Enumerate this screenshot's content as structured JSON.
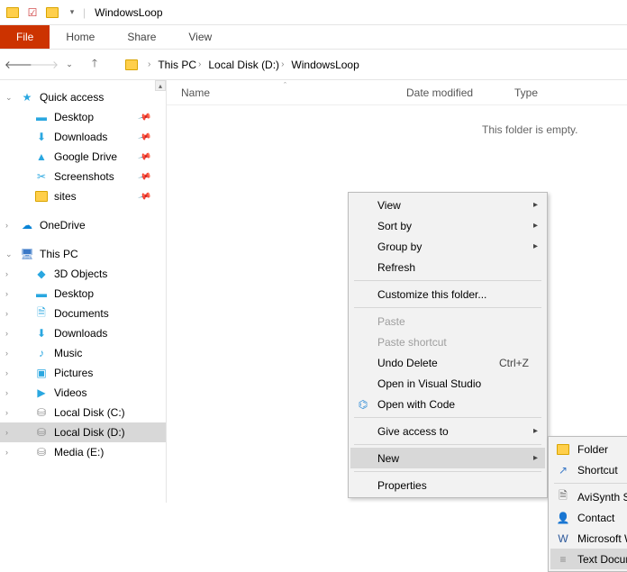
{
  "window": {
    "title": "WindowsLoop"
  },
  "ribbon": {
    "file": "File",
    "tabs": [
      "Home",
      "Share",
      "View"
    ]
  },
  "breadcrumb": [
    "This PC",
    "Local Disk (D:)",
    "WindowsLoop"
  ],
  "columns": {
    "name": "Name",
    "date": "Date modified",
    "type": "Type"
  },
  "empty_message": "This folder is empty.",
  "sidebar": {
    "quick_access": "Quick access",
    "qa_items": [
      {
        "label": "Desktop",
        "icon": "desktop",
        "pinned": true
      },
      {
        "label": "Downloads",
        "icon": "downloads",
        "pinned": true
      },
      {
        "label": "Google Drive",
        "icon": "gdrive",
        "pinned": true
      },
      {
        "label": "Screenshots",
        "icon": "scissors",
        "pinned": true
      },
      {
        "label": "sites",
        "icon": "folder",
        "pinned": true
      }
    ],
    "onedrive": "OneDrive",
    "this_pc": "This PC",
    "pc_items": [
      {
        "label": "3D Objects",
        "icon": "3d"
      },
      {
        "label": "Desktop",
        "icon": "desktop"
      },
      {
        "label": "Documents",
        "icon": "docs"
      },
      {
        "label": "Downloads",
        "icon": "downloads"
      },
      {
        "label": "Music",
        "icon": "music"
      },
      {
        "label": "Pictures",
        "icon": "pictures"
      },
      {
        "label": "Videos",
        "icon": "videos"
      },
      {
        "label": "Local Disk (C:)",
        "icon": "disk"
      },
      {
        "label": "Local Disk (D:)",
        "icon": "disk",
        "selected": true
      },
      {
        "label": "Media (E:)",
        "icon": "disk"
      }
    ]
  },
  "ctx_main": [
    {
      "label": "View",
      "arrow": true
    },
    {
      "label": "Sort by",
      "arrow": true
    },
    {
      "label": "Group by",
      "arrow": true
    },
    {
      "label": "Refresh"
    },
    {
      "sep": true
    },
    {
      "label": "Customize this folder..."
    },
    {
      "sep": true
    },
    {
      "label": "Paste",
      "disabled": true
    },
    {
      "label": "Paste shortcut",
      "disabled": true
    },
    {
      "label": "Undo Delete",
      "shortcut": "Ctrl+Z"
    },
    {
      "label": "Open in Visual Studio"
    },
    {
      "label": "Open with Code",
      "icon": "vscode"
    },
    {
      "sep": true
    },
    {
      "label": "Give access to",
      "arrow": true
    },
    {
      "sep": true
    },
    {
      "label": "New",
      "arrow": true,
      "hover": true
    },
    {
      "sep": true
    },
    {
      "label": "Properties"
    }
  ],
  "ctx_new": [
    {
      "label": "Folder",
      "icon": "folder"
    },
    {
      "label": "Shortcut",
      "icon": "shortcut"
    },
    {
      "sep": true
    },
    {
      "label": "AviSynth Script",
      "icon": "doc"
    },
    {
      "label": "Contact",
      "icon": "contact"
    },
    {
      "label": "Microsoft Word Document",
      "icon": "word"
    },
    {
      "label": "Text Document",
      "icon": "text",
      "hover": true
    }
  ]
}
